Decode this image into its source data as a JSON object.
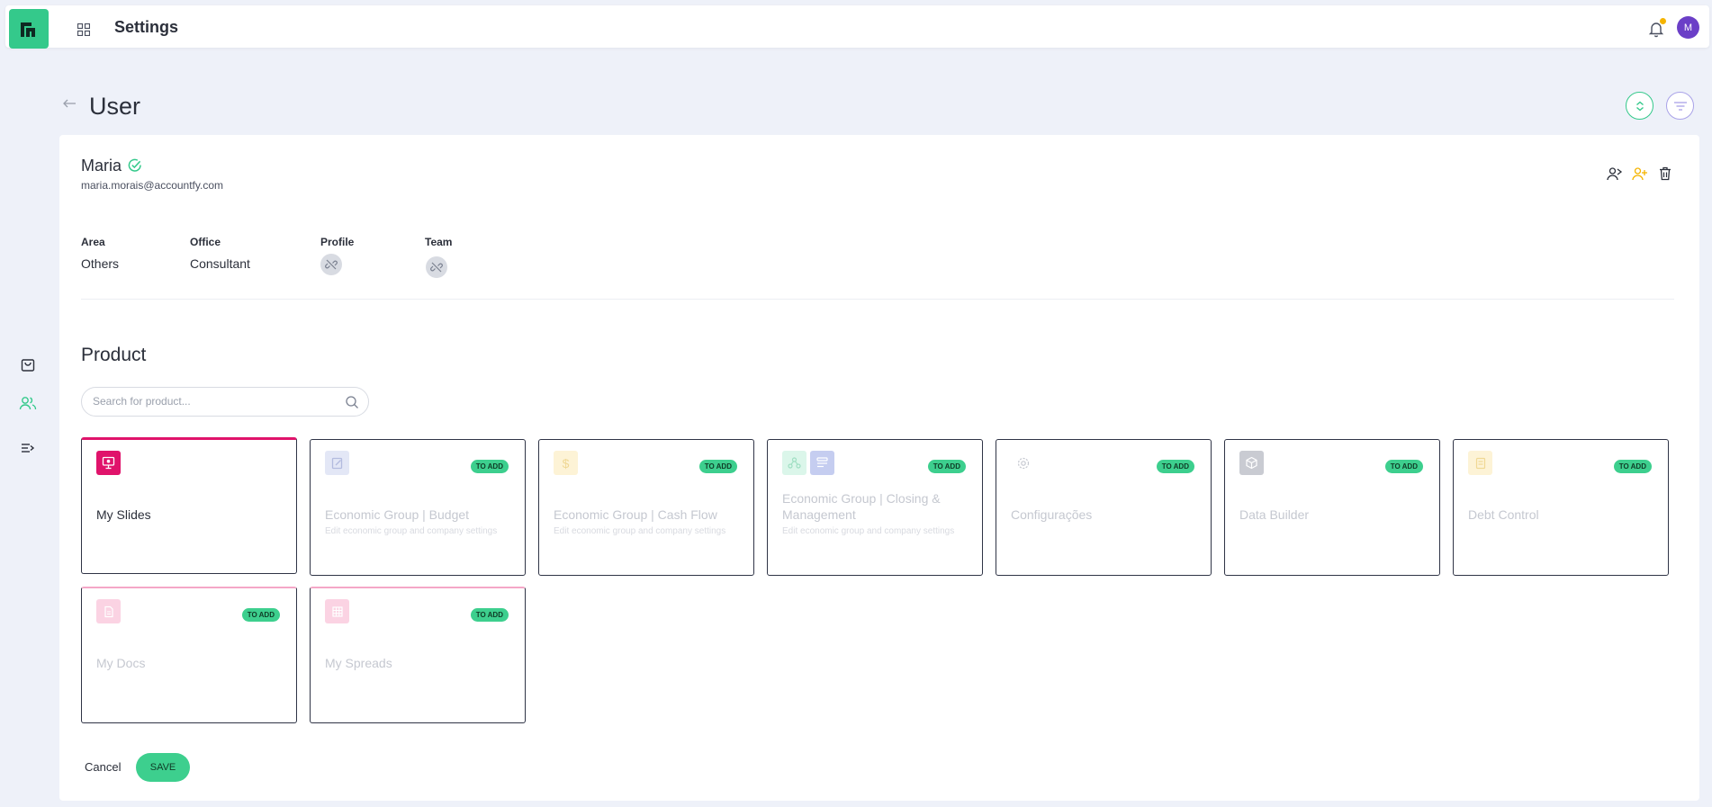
{
  "topbar": {
    "title": "Settings",
    "avatar_initial": "M",
    "notification_dot_color": "#f5b400"
  },
  "rail": {
    "items": [
      {
        "icon": "shopping-bag-icon"
      },
      {
        "icon": "users-icon",
        "active": true
      },
      {
        "icon": "menu-expand-icon"
      }
    ]
  },
  "page": {
    "title": "User"
  },
  "user": {
    "name": "Maria",
    "email": "maria.morais@accountfy.com",
    "verified": true
  },
  "info": {
    "area_label": "Area",
    "area_value": "Others",
    "office_label": "Office",
    "office_value": "Consultant",
    "profile_label": "Profile",
    "team_label": "Team"
  },
  "product": {
    "section_title": "Product",
    "search_placeholder": "Search for product...",
    "cards": [
      {
        "title": "My Slides",
        "desc": "",
        "badge": "",
        "active": true
      },
      {
        "title": "Economic Group | Budget",
        "desc": "Edit economic group and company settings",
        "badge": "TO ADD"
      },
      {
        "title": "Economic Group | Cash Flow",
        "desc": "Edit economic group and company settings",
        "badge": "TO ADD"
      },
      {
        "title": "Economic Group | Closing & Management",
        "desc": "Edit economic group and company settings",
        "badge": "TO ADD"
      },
      {
        "title": "Configurações",
        "desc": "",
        "badge": "TO ADD"
      },
      {
        "title": "Data Builder",
        "desc": "",
        "badge": "TO ADD"
      },
      {
        "title": "Debt Control",
        "desc": "",
        "badge": "TO ADD"
      },
      {
        "title": "My Docs",
        "desc": "",
        "badge": "TO ADD"
      },
      {
        "title": "My Spreads",
        "desc": "",
        "badge": "TO ADD"
      }
    ]
  },
  "actions": {
    "cancel_label": "Cancel",
    "save_label": "SAVE"
  },
  "colors": {
    "brand": "#34c98b",
    "accent_pink": "#e0136b",
    "badge_green": "#3dcf8e",
    "avatar_purple": "#6b3fc7"
  }
}
